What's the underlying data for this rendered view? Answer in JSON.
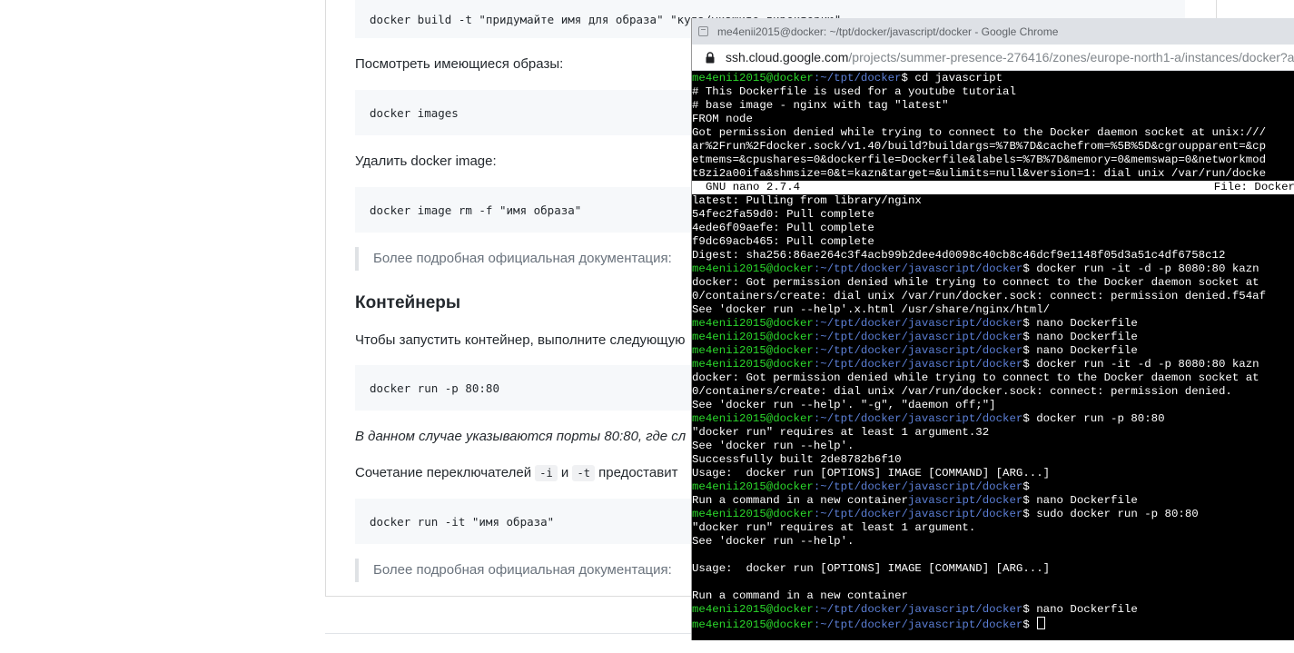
{
  "article": {
    "code_docker_build": "docker build -t \"придумайте имя для образа\" \"куда/укажите директорию\"",
    "text_view_images": "Посмотреть имеющиеся образы:",
    "code_docker_images": "docker images",
    "text_delete_image": "Удалить docker image:",
    "code_image_rm": "docker image rm -f \"имя образа\"",
    "quote_docs_1": "Более подробная официальная документация:",
    "heading_containers": "Контейнеры",
    "text_run_container": "Чтобы запустить контейнер, выполните следующую",
    "code_run_ports": "docker run -p 80:80",
    "text_ports_note": "В данном случае указываются порты 80:80, где сл",
    "text_switches_prefix": "Сочетание переключателей",
    "switch_i": "-i",
    "text_and": "и",
    "switch_t": "-t",
    "text_switches_suffix": "предоставит",
    "code_run_it": "docker run -it \"имя образа\"",
    "quote_docs_2": "Более подробная официальная документация:"
  },
  "chrome": {
    "title": "me4enii2015@docker: ~/tpt/docker/javascript/docker - Google Chrome",
    "url_host": "ssh.cloud.google.com",
    "url_path": "/projects/summer-presence-276416/zones/europe-north1-a/instances/docker?a"
  },
  "terminal": {
    "prompt_user": "me4enii2015@docker",
    "lines": [
      {
        "kind": "prompt",
        "path": ":~/tpt/docker",
        "cmd": "$ cd javascript"
      },
      {
        "kind": "text",
        "text": "# This Dockerfile is used for a youtube tutorial"
      },
      {
        "kind": "text",
        "text": "# base image - nginx with tag \"latest\""
      },
      {
        "kind": "text",
        "text": "FROM node"
      },
      {
        "kind": "text",
        "text": "Got permission denied while trying to connect to the Docker daemon socket at unix:///"
      },
      {
        "kind": "text",
        "text": "ar%2Frun%2Fdocker.sock/v1.40/build?buildargs=%7B%7D&cachefrom=%5B%5D&cgroupparent=&cp"
      },
      {
        "kind": "text",
        "text": "etmems=&cpushares=0&dockerfile=Dockerfile&labels=%7B%7D&memory=0&memswap=0&networkmod"
      },
      {
        "kind": "text",
        "text": "t8zi2a00ifa&shmsize=0&t=kazn&target=&ulimits=null&version=1: dial unix /var/run/docke"
      },
      {
        "kind": "nano",
        "left": "GNU nano 2.7.4",
        "right": "File: Docker"
      },
      {
        "kind": "text",
        "text": "latest: Pulling from library/nginx"
      },
      {
        "kind": "text",
        "text": "54fec2fa59d0: Pull complete"
      },
      {
        "kind": "text",
        "text": "4ede6f09aefe: Pull complete"
      },
      {
        "kind": "text",
        "text": "f9dc69acb465: Pull complete"
      },
      {
        "kind": "text",
        "text": "Digest: sha256:86ae264c3f4acb99b2dee4d0098c40cb8c46dcf9e1148f05d3a51c4df6758c12"
      },
      {
        "kind": "prompt",
        "path": ":~/tpt/docker/javascript/docker",
        "cmd": "$ docker run -it -d -p 8080:80 kazn"
      },
      {
        "kind": "text",
        "text": "docker: Got permission denied while trying to connect to the Docker daemon socket at"
      },
      {
        "kind": "text",
        "text": "0/containers/create: dial unix /var/run/docker.sock: connect: permission denied.f54af"
      },
      {
        "kind": "text",
        "text": "See 'docker run --help'.x.html /usr/share/nginx/html/"
      },
      {
        "kind": "prompt",
        "path": ":~/tpt/docker/javascript/docker",
        "cmd": "$ nano Dockerfile"
      },
      {
        "kind": "prompt",
        "path": ":~/tpt/docker/javascript/docker",
        "cmd": "$ nano Dockerfile"
      },
      {
        "kind": "prompt",
        "path": ":~/tpt/docker/javascript/docker",
        "cmd": "$ nano Dockerfile"
      },
      {
        "kind": "prompt",
        "path": ":~/tpt/docker/javascript/docker",
        "cmd": "$ docker run -it -d -p 8080:80 kazn"
      },
      {
        "kind": "text",
        "text": "docker: Got permission denied while trying to connect to the Docker daemon socket at"
      },
      {
        "kind": "text",
        "text": "0/containers/create: dial unix /var/run/docker.sock: connect: permission denied."
      },
      {
        "kind": "text",
        "text": "See 'docker run --help'. \"-g\", \"daemon off;\"]"
      },
      {
        "kind": "prompt",
        "path": ":~/tpt/docker/javascript/docker",
        "cmd": "$ docker run -p 80:80"
      },
      {
        "kind": "text",
        "text": "\"docker run\" requires at least 1 argument.32"
      },
      {
        "kind": "text",
        "text": "See 'docker run --help'."
      },
      {
        "kind": "text",
        "text": "Successfully built 2de8782b6f10"
      },
      {
        "kind": "text",
        "text": "Usage:  docker run [OPTIONS] IMAGE [COMMAND] [ARG...]"
      },
      {
        "kind": "prompt",
        "path": ":~/tpt/docker/javascript/docker",
        "cmd": "$"
      },
      {
        "kind": "mixed",
        "text": "Run a command in a new container",
        "path": "javascript/docker",
        "cmd": "$ nano Dockerfile"
      },
      {
        "kind": "prompt",
        "path": ":~/tpt/docker/javascript/docker",
        "cmd": "$ sudo docker run -p 80:80"
      },
      {
        "kind": "text",
        "text": "\"docker run\" requires at least 1 argument."
      },
      {
        "kind": "text",
        "text": "See 'docker run --help'."
      },
      {
        "kind": "text",
        "text": ""
      },
      {
        "kind": "text",
        "text": "Usage:  docker run [OPTIONS] IMAGE [COMMAND] [ARG...]"
      },
      {
        "kind": "text",
        "text": ""
      },
      {
        "kind": "text",
        "text": "Run a command in a new container"
      },
      {
        "kind": "prompt",
        "path": ":~/tpt/docker/javascript/docker",
        "cmd": "$ nano Dockerfile"
      },
      {
        "kind": "prompt",
        "path": ":~/tpt/docker/javascript/docker",
        "cmd": "$ ",
        "cursor": true
      }
    ]
  }
}
